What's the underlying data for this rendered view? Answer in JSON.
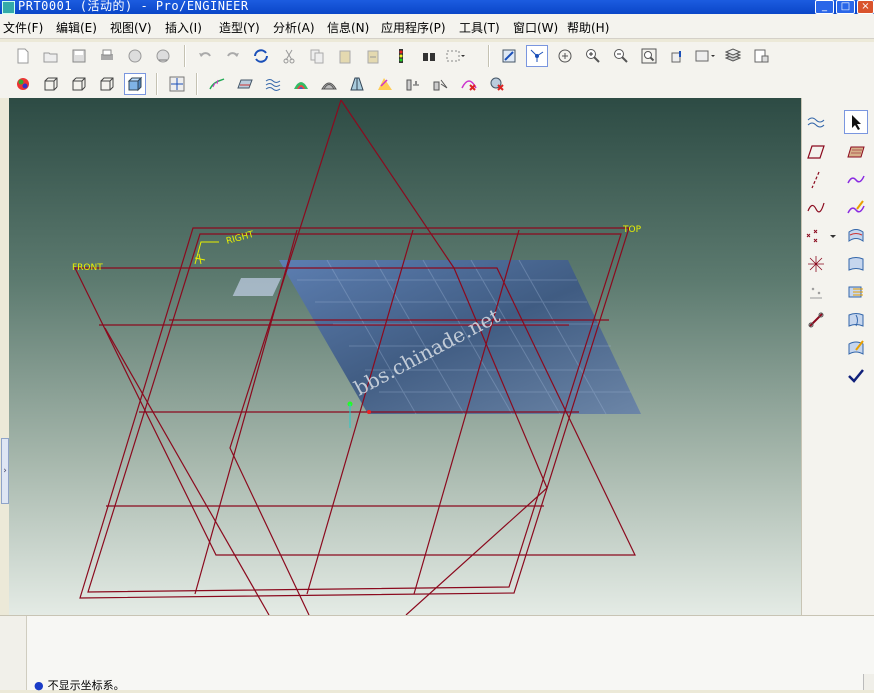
{
  "window": {
    "title": "PRT0001 (活动的) - Pro/ENGINEER",
    "min_glyph": "_",
    "max_glyph": "□",
    "close_glyph": "×"
  },
  "menu": [
    {
      "label": "文件(F)"
    },
    {
      "label": "编辑(E)"
    },
    {
      "label": "视图(V)"
    },
    {
      "label": "插入(I)"
    },
    {
      "label": "造型(Y)"
    },
    {
      "label": "分析(A)"
    },
    {
      "label": "信息(N)"
    },
    {
      "label": "应用程序(P)"
    },
    {
      "label": "工具(T)"
    },
    {
      "label": "窗口(W)"
    },
    {
      "label": "帮助(H)"
    }
  ],
  "toolbar1": {
    "icons": [
      "new-file-icon",
      "open-file-icon",
      "save-icon",
      "print-icon",
      "email-icon",
      "email-link-icon",
      "undo-icon",
      "redo-icon",
      "regenerate-icon",
      "cut-icon",
      "copy-icon",
      "paste-icon",
      "paste-special-icon",
      "traffic-light-icon",
      "find-icon",
      "select-box-icon",
      "repaint-icon",
      "spin-center-icon",
      "orient-icon",
      "zoom-in-icon",
      "zoom-out-icon",
      "refit-icon",
      "reorient-icon",
      "saved-views-icon",
      "layers-icon",
      "view-manager-icon"
    ]
  },
  "toolbar2": {
    "icons": [
      "shading-icon",
      "wireframe-icon",
      "hidden-line-icon",
      "no-hidden-icon",
      "shaded-icon",
      "datum-display-icon",
      "curvature-analysis-icon",
      "surface-curvature-icon",
      "reflection-icon",
      "slope-icon",
      "draft-icon",
      "dihedral-icon",
      "dihedral-check-icon",
      "offset-icon",
      "deviation-icon",
      "delete-analysis-icon",
      "delete-all-analysis-icon"
    ]
  },
  "right_panel": {
    "col1_icons": [
      "curvature-icon",
      "datum-plane-icon",
      "axis-line-icon",
      "sketched-curve-icon",
      "point-icon",
      "point-set-icon",
      "offset-point-icon",
      "chain-icon"
    ],
    "col2_icons": [
      "select-arrow-icon",
      "style-plane-icon",
      "style-curve-icon",
      "curve-edit-icon",
      "boundary-surface-icon",
      "surface-connect-icon",
      "surface-trim-icon",
      "surface-edit-icon",
      "curve-from-surface-icon",
      "done-check-icon"
    ]
  },
  "viewport": {
    "labels": {
      "front": "FRONT",
      "top": "TOP",
      "right": "RIGHT"
    },
    "watermark": "bbs.chinade.net"
  },
  "status": {
    "message": "不显示坐标系。",
    "bullet": "●"
  },
  "colors": {
    "datum_plane": "#8b0a1e",
    "datum_label": "#e8f000",
    "surface": "#4a6a95"
  }
}
